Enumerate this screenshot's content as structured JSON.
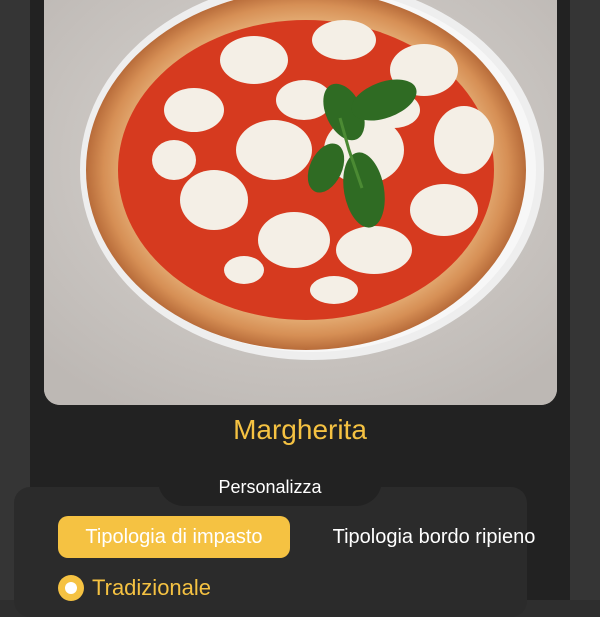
{
  "product": {
    "name": "Margherita",
    "image_alt": "pizza margherita photo"
  },
  "customize": {
    "label": "Personalizza",
    "tabs": [
      {
        "label": "Tipologia di impasto",
        "active": true
      },
      {
        "label": "Tipologia bordo ripieno",
        "active": false
      }
    ],
    "options": [
      {
        "label": "Tradizionale",
        "selected": true
      }
    ]
  },
  "colors": {
    "accent": "#f5c242",
    "background": "#222222",
    "panel": "#2b2b2b"
  }
}
